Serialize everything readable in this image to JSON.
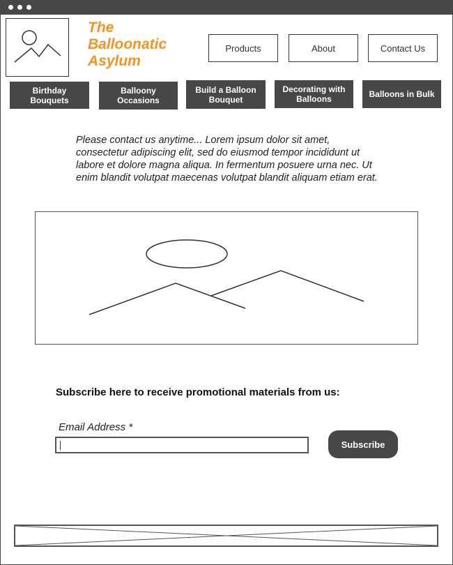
{
  "window": {
    "controls": [
      "dot",
      "dot",
      "dot"
    ]
  },
  "header": {
    "logo_icon": "image-placeholder-icon",
    "site_title_line1": "The",
    "site_title_line2": "Balloonatic",
    "site_title_line3": "Asylum",
    "title_color": "#f7941d"
  },
  "top_nav": {
    "products": "Products",
    "about": "About",
    "contact": "Contact Us"
  },
  "categories": {
    "birthday": "Birthday Bouquets",
    "occasions": "Balloony Occasions",
    "build": "Build a Balloon Bouquet",
    "decorating": "Decorating with Balloons",
    "bulk": "Balloons in Bulk"
  },
  "main": {
    "intro_text": "Please contact us anytime... Lorem ipsum dolor sit amet, consectetur adipiscing elit, sed do eiusmod tempor incididunt ut labore et dolore magna aliqua. In fermentum posuere urna nec. Ut enim blandit volutpat maecenas volutpat blandit aliquam etiam erat.",
    "hero_icon": "image-placeholder-icon"
  },
  "subscribe": {
    "heading": "Subscribe here to receive promotional materials from us:",
    "email_label": "Email Address *",
    "email_value": "",
    "button_label": "Subscribe"
  },
  "footer": {
    "placeholder_icon": "x-placeholder-icon"
  },
  "colors": {
    "accent": "#f7941d",
    "dark": "#474747",
    "border": "#333333"
  }
}
